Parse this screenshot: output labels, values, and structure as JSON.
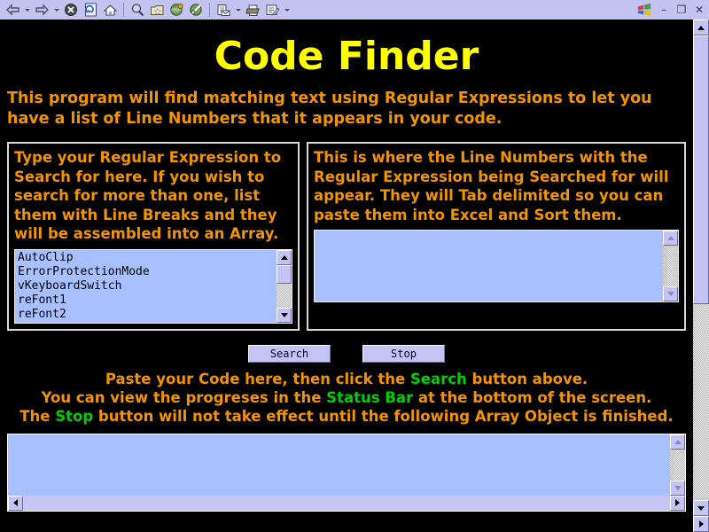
{
  "browser": {
    "toolbar_buttons": [
      {
        "name": "back-icon",
        "glyph": "⇦",
        "has_dropdown": true
      },
      {
        "name": "forward-icon",
        "glyph": "⇨",
        "has_dropdown": true
      },
      {
        "name": "stop-icon",
        "glyph": "⊗",
        "has_dropdown": false
      },
      {
        "name": "refresh-icon",
        "glyph": "↻",
        "has_dropdown": false
      },
      {
        "name": "home-icon",
        "glyph": "⌂",
        "has_dropdown": false
      },
      {
        "name": "search-icon",
        "glyph": "⌕",
        "has_dropdown": false
      },
      {
        "name": "favorites-icon",
        "glyph": "★",
        "has_dropdown": false
      },
      {
        "name": "history-icon",
        "glyph": "◔",
        "has_dropdown": false
      },
      {
        "name": "media-icon",
        "glyph": "◑",
        "has_dropdown": false
      },
      {
        "name": "mail-icon",
        "glyph": "✉",
        "has_dropdown": true
      },
      {
        "name": "print-icon",
        "glyph": "⎙",
        "has_dropdown": false
      },
      {
        "name": "edit-icon",
        "glyph": "✎",
        "has_dropdown": true
      }
    ],
    "window_controls": {
      "logo": "windows-logo-icon",
      "minimize": "–",
      "restore": "❐",
      "close": "✕"
    },
    "toolbar_bg": "#c3c3f0"
  },
  "page": {
    "title": "Code Finder",
    "title_color": "#ffff00",
    "background": "#000000",
    "body_text_color": "#f29400",
    "highlight_color": "#00d000",
    "intro": "This program will find matching text using Regular Expressions to let you have a list of Line Numbers that it appears in your code."
  },
  "left_panel": {
    "instructions": "Type your Regular Expression to Search for here. If you wish to search for more than one, list them with Line Breaks and they will be assembled into an Array.",
    "textarea_value": "AutoClip\nErrorProtectionMode\nvKeyboardSwitch\nreFont1\nreFont2",
    "textarea_lines": [
      "AutoClip",
      "ErrorProtectionMode",
      "vKeyboardSwitch",
      "reFont1",
      "reFont2"
    ],
    "textarea_bg": "#a8c0ff"
  },
  "right_panel": {
    "instructions": "This is where the Line Numbers with the Regular Expression being Searched for will appear. They will Tab delimited so you can paste them into Excel and Sort them.",
    "textarea_value": "",
    "textarea_bg": "#a8c0ff"
  },
  "actions": {
    "search_label": "Search",
    "stop_label": "Stop"
  },
  "hints": {
    "line1_a": "Paste your Code here, then click the ",
    "line1_kw": "Search",
    "line1_b": " button above.",
    "line2_a": "You can view the progreses in the ",
    "line2_kw": "Status Bar",
    "line2_b": " at the bottom of the screen.",
    "line3_a": "The ",
    "line3_kw": "Stop",
    "line3_b": " button will not take effect until the following Array Object is finished."
  },
  "code_input": {
    "value": "",
    "background": "#a8c0ff"
  }
}
